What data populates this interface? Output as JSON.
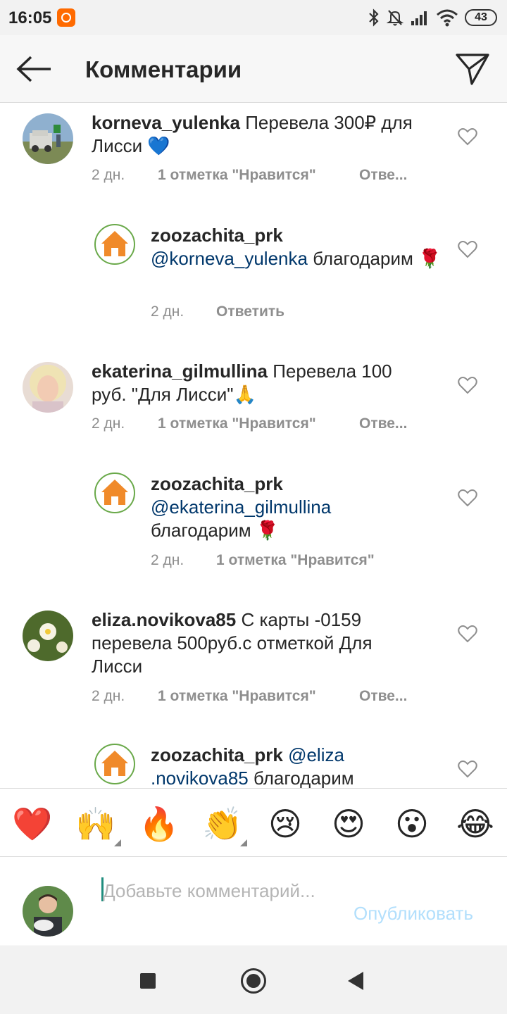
{
  "status_bar": {
    "time": "16:05",
    "battery": "43"
  },
  "app_bar": {
    "title": "Комментарии"
  },
  "comments": [
    {
      "user": "korneva_yulenka",
      "text": " Перевела 300₽ для Лисси 💙",
      "time": "2 дн.",
      "likes": "1 отметка \"Нравится\"",
      "reply": "Отве..."
    },
    {
      "user": "zoozachita_prk",
      "mention": "@korneva_yulenka",
      "text": " благодарим 🌹",
      "time": "2 дн.",
      "reply": "Ответить"
    },
    {
      "user": "ekaterina_gilmullina",
      "text": " Перевела 100 руб. \"Для Лисси\"🙏",
      "time": "2 дн.",
      "likes": "1 отметка \"Нравится\"",
      "reply": "Отве..."
    },
    {
      "user": "zoozachita_prk",
      "mention": "@ekaterina_gilmullina",
      "text": " благодарим 🌹",
      "time": "2 дн.",
      "likes": "1 отметка \"Нравится\""
    },
    {
      "user": "eliza.novikova85",
      "text": " С карты -0159 перевела 500руб.с отметкой Для Лисси",
      "time": "2 дн.",
      "likes": "1 отметка \"Нравится\"",
      "reply": "Отве..."
    },
    {
      "user": "zoozachita_prk",
      "mention": "@eliza .novikova85",
      "text": " благодарим"
    }
  ],
  "reactions": [
    "❤️",
    "🙌",
    "🔥",
    "👏",
    "😢",
    "😍",
    "😮",
    "😂"
  ],
  "composer": {
    "placeholder": "Добавьте комментарий...",
    "publish_label": "Опубликовать"
  }
}
